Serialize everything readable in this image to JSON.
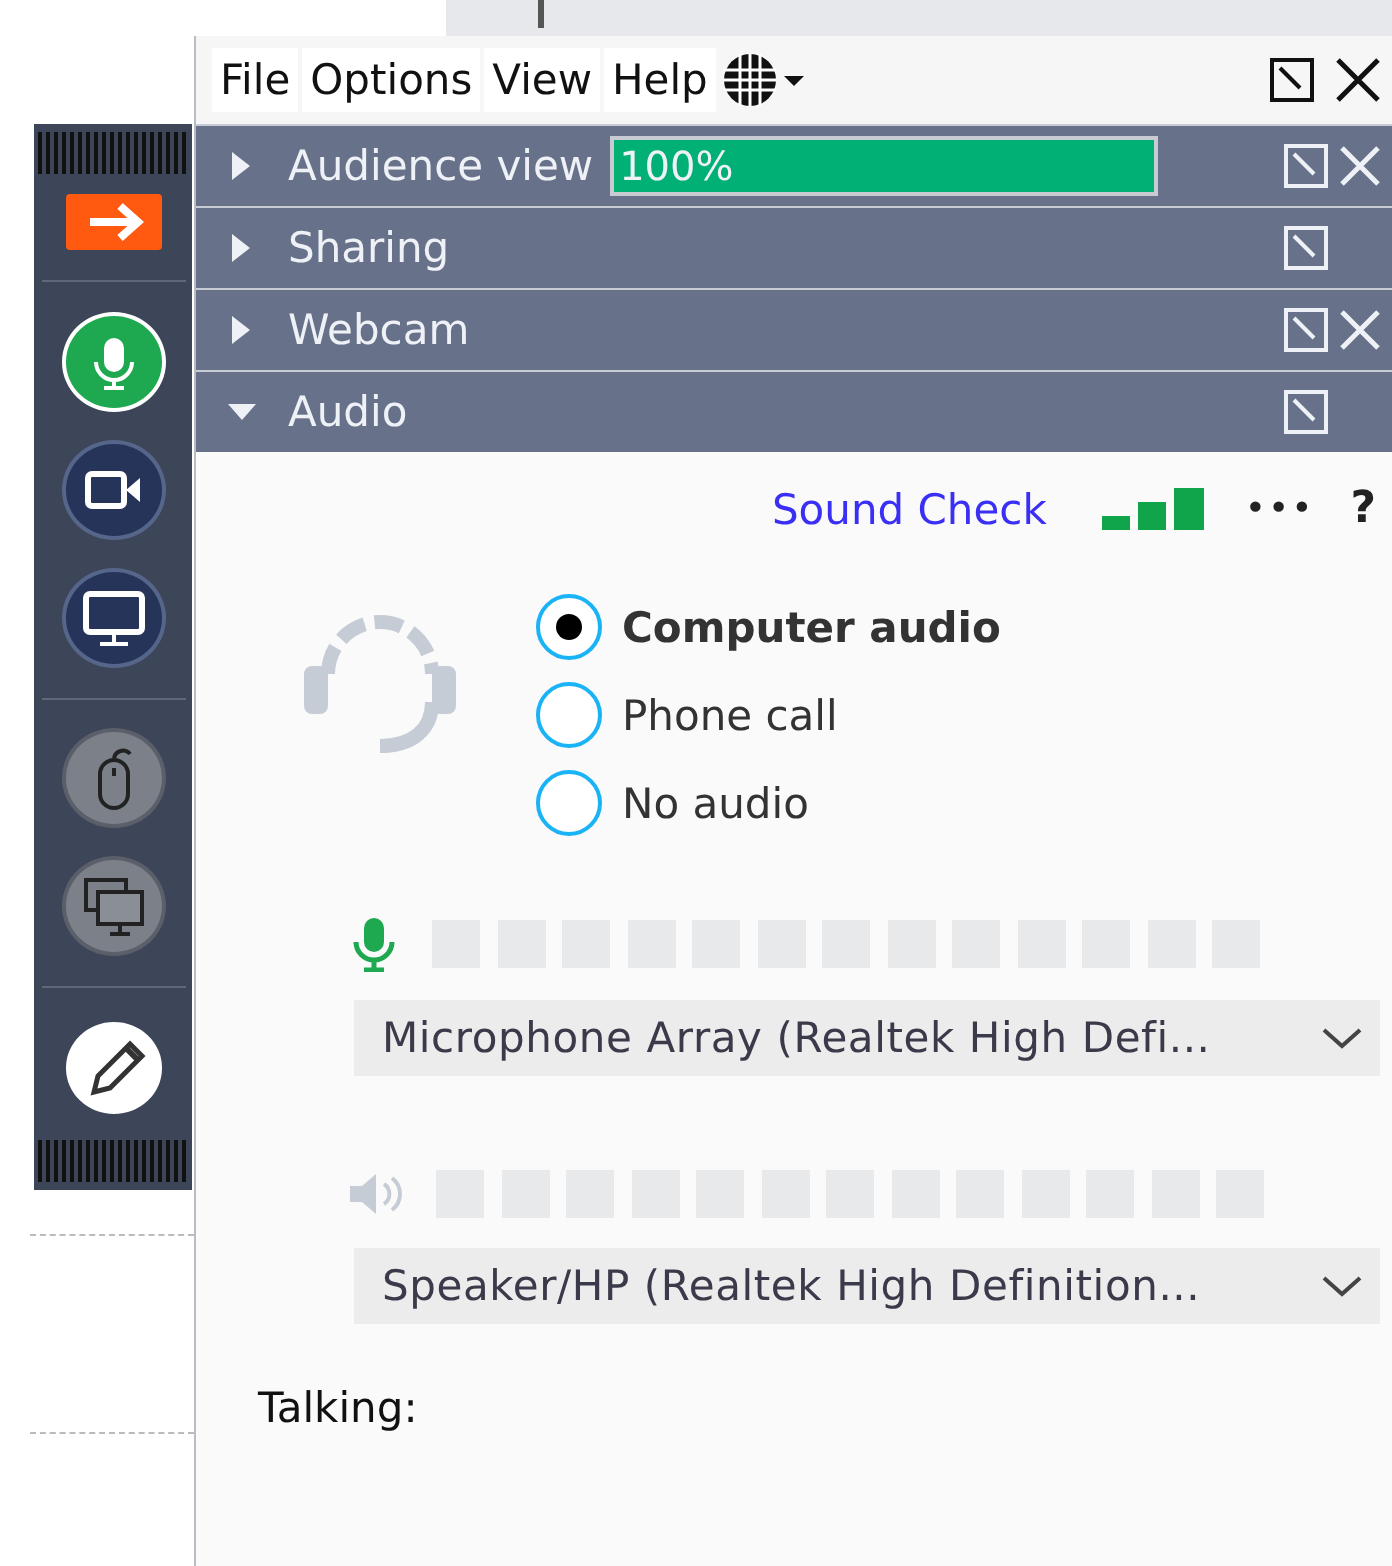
{
  "toolbar": [
    {
      "kind": "arrow",
      "disabled": false
    },
    {
      "kind": "mic",
      "disabled": false
    },
    {
      "kind": "webcam",
      "disabled": false
    },
    {
      "kind": "screen",
      "disabled": false
    },
    {
      "kind": "mouse",
      "disabled": true
    },
    {
      "kind": "screens",
      "disabled": true
    },
    {
      "kind": "pencil",
      "disabled": false
    }
  ],
  "menu": [
    "File",
    "Options",
    "View",
    "Help"
  ],
  "sections": [
    {
      "title": "Audience view",
      "expanded": false,
      "closable": true,
      "level": 1,
      "reading": "100%"
    },
    {
      "title": "Sharing",
      "expanded": false,
      "closable": false
    },
    {
      "title": "Webcam",
      "expanded": false,
      "closable": true
    },
    {
      "title": "Audio",
      "expanded": true,
      "closable": false
    }
  ],
  "audio": {
    "sound_check": "Sound Check",
    "more": "•••",
    "help": "?",
    "options": [
      {
        "label": "Computer audio",
        "selected": true
      },
      {
        "label": "Phone call",
        "selected": false
      },
      {
        "label": "No audio",
        "selected": false
      }
    ],
    "microphone": {
      "level": 0,
      "device": "Microphone Array (Realtek High Defi..."
    },
    "speaker": {
      "level": 0,
      "device": "Speaker/HP (Realtek High Definition..."
    },
    "talking": "Talking:"
  }
}
